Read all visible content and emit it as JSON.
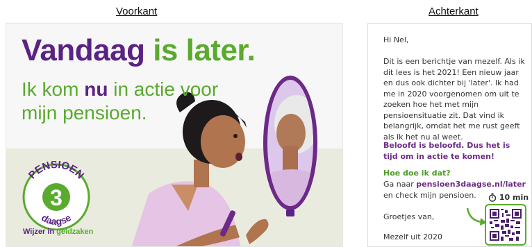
{
  "captions": {
    "front": "Voorkant",
    "back": "Achterkant"
  },
  "front": {
    "headline_part1": "Vandaag",
    "headline_part2": " is later.",
    "sub_line1_a": "Ik kom ",
    "sub_line1_nu": "nu",
    "sub_line1_b": " in actie voor",
    "sub_line2": "mijn pensioen.",
    "logo_top": "PENSIOEN",
    "logo_number": "3",
    "logo_bottom": "daagse",
    "tagline_a": "Wijzer in ",
    "tagline_b": "geldzaken"
  },
  "back": {
    "greeting": "Hi Nel,",
    "paragraph": "Dit is een berichtje van mezelf. Als ik dit lees is het 2021! Een nieuw jaar en dus ook dichter bij 'later'. Ik had me in 2020 voorgenomen om uit te zoeken hoe het met mijn pensioensituatie zit. Dat vind ik belangrijk, omdat het me rust geeft als ik het nu al weet.",
    "promise": "Beloofd is beloofd. Dus het is tijd om in actie te komen!",
    "how_title": "Hoe doe ik dat?",
    "go_to": "Ga naar ",
    "url": "pensioen3daagse.nl/later",
    "check": "en check mijn pensioen.",
    "regards": "Groetjes van,",
    "signature": "Mezelf uit 2020",
    "timer_label": "10 min"
  },
  "colors": {
    "purple": "#5a2383",
    "green": "#5aaa2e",
    "floor": "#e9ebde",
    "skin": "#b0744f",
    "robe": "#e5c4e6"
  },
  "icons": [
    "stopwatch-icon",
    "qr-code-icon",
    "arrow-icon",
    "pensioen3daagse-logo"
  ]
}
